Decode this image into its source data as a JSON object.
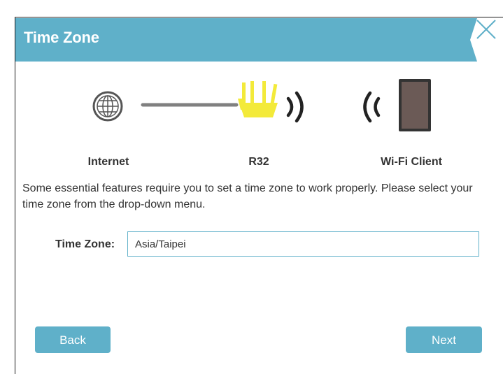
{
  "header": {
    "title": "Time Zone"
  },
  "topology": {
    "internet_label": "Internet",
    "router_label": "R32",
    "client_label": "Wi-Fi Client"
  },
  "description": "Some essential features require you to set a time zone to work properly. Please select your time zone from the drop-down menu.",
  "form": {
    "time_zone_label": "Time Zone:",
    "time_zone_value": "Asia/Taipei"
  },
  "buttons": {
    "back": "Back",
    "next": "Next"
  },
  "colors": {
    "accent": "#5fb0c9",
    "router": "#f3ea3a",
    "line": "#808080",
    "text": "#333333"
  },
  "icons": {
    "close": "close-icon",
    "internet": "globe-icon",
    "router": "router-icon",
    "wifi": "wifi-signal-icon",
    "client": "tablet-icon"
  }
}
